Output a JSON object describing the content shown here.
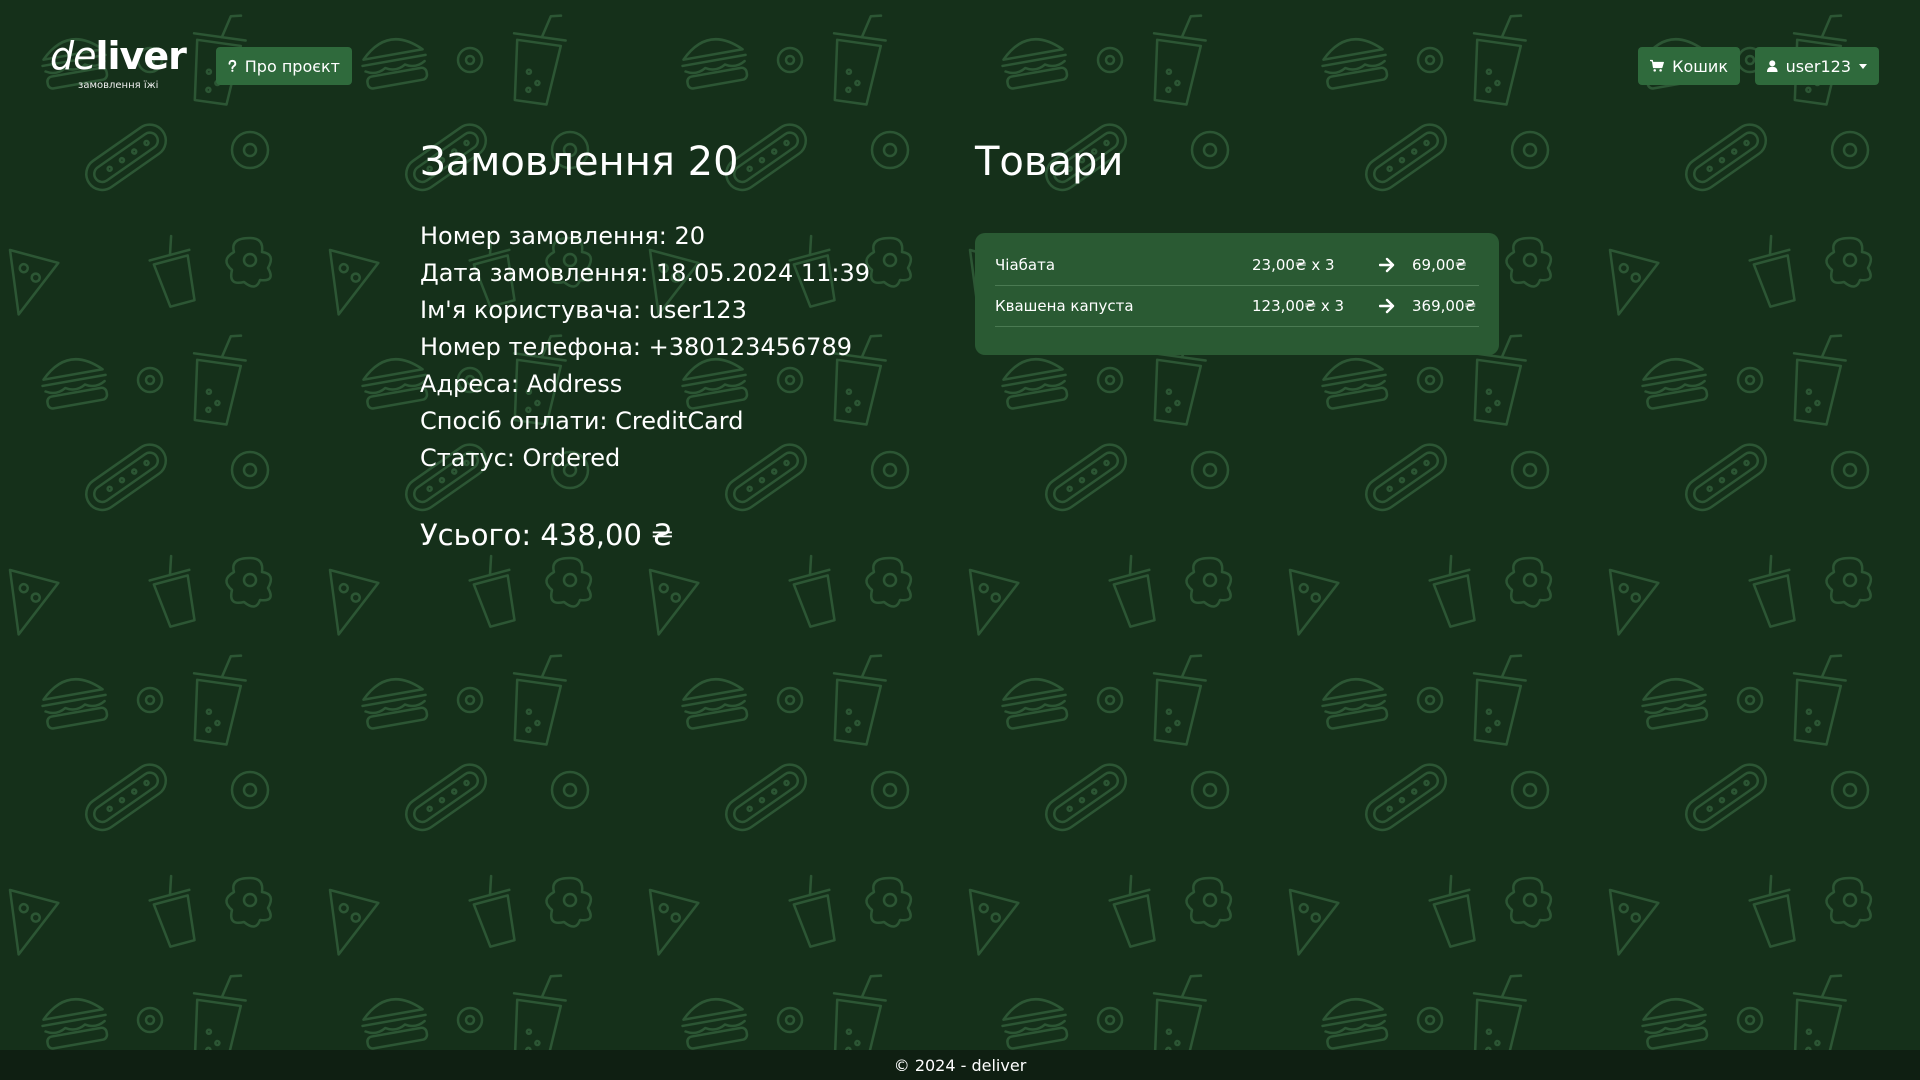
{
  "app": {
    "logo_prefix": "de",
    "logo_suffix": "liver",
    "logo_tagline": "замовлення їжі"
  },
  "nav": {
    "about_label": "Про проєкт",
    "cart_label": "Кошик",
    "user_label": "user123",
    "about_icon": "question-icon",
    "cart_icon": "cart-icon",
    "user_icon": "user-icon"
  },
  "order": {
    "title": "Замовлення 20",
    "lines": [
      "Номер замовлення: 20",
      "Дата замовлення: 18.05.2024 11:39",
      "Ім'я користувача: user123",
      "Номер телефона: +380123456789",
      "Адреса: Address",
      "Спосіб оплати: CreditCard",
      "Статус: Ordered"
    ],
    "total": "Усього: 438,00 ₴"
  },
  "items": {
    "title": "Товари",
    "rows": [
      {
        "name": "Чіабата",
        "price": "23,00₴ x 3",
        "total": "69,00₴"
      },
      {
        "name": "Квашена капуста",
        "price": "123,00₴ x 3",
        "total": "369,00₴"
      }
    ]
  },
  "footer": {
    "text": "© 2024 - deliver"
  },
  "colors": {
    "background": "#15301a",
    "button": "#2f6a3c",
    "card": "#2a5a33",
    "footer": "#0f1f12",
    "pattern_stroke": "#2c5634"
  }
}
